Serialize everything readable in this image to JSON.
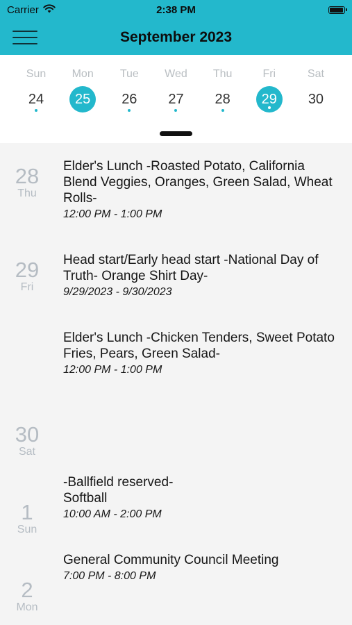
{
  "status_bar": {
    "carrier": "Carrier",
    "time": "2:38 PM",
    "battery_level": 0.95
  },
  "header": {
    "title": "September 2023"
  },
  "week": [
    {
      "dow": "Sun",
      "day": "24",
      "has_events": true,
      "selected": false
    },
    {
      "dow": "Mon",
      "day": "25",
      "has_events": false,
      "selected": true
    },
    {
      "dow": "Tue",
      "day": "26",
      "has_events": true,
      "selected": false
    },
    {
      "dow": "Wed",
      "day": "27",
      "has_events": true,
      "selected": false
    },
    {
      "dow": "Thu",
      "day": "28",
      "has_events": true,
      "selected": false
    },
    {
      "dow": "Fri",
      "day": "29",
      "has_events": true,
      "selected": true
    },
    {
      "dow": "Sat",
      "day": "30",
      "has_events": false,
      "selected": false
    }
  ],
  "agenda": [
    {
      "date_num": "28",
      "date_dow": "Thu",
      "events": [
        {
          "title": "Elder's Lunch -Roasted Potato, California Blend Veggies, Oranges, Green Salad, Wheat Rolls-",
          "time": "12:00 PM - 1:00 PM"
        }
      ]
    },
    {
      "date_num": "29",
      "date_dow": "Fri",
      "events": [
        {
          "title": "Head start/Early head start -National Day of Truth- Orange Shirt Day-",
          "time": "9/29/2023 - 9/30/2023"
        },
        {
          "title": "Elder's Lunch -Chicken Tenders, Sweet Potato Fries, Pears, Green Salad-",
          "time": "12:00 PM - 1:00 PM"
        }
      ]
    },
    {
      "date_num": "30",
      "date_dow": "Sat",
      "events": []
    },
    {
      "date_num": "1",
      "date_dow": "Sun",
      "events": [
        {
          "title": "-Ballfield reserved-\nSoftball",
          "time": "10:00 AM - 2:00 PM"
        }
      ]
    },
    {
      "date_num": "2",
      "date_dow": "Mon",
      "events": [
        {
          "title": "General Community Council Meeting",
          "time": "7:00 PM - 8:00 PM"
        }
      ]
    }
  ],
  "colors": {
    "accent": "#23b8cc",
    "muted_date": "#b5bcc3",
    "background": "#f4f4f4"
  }
}
